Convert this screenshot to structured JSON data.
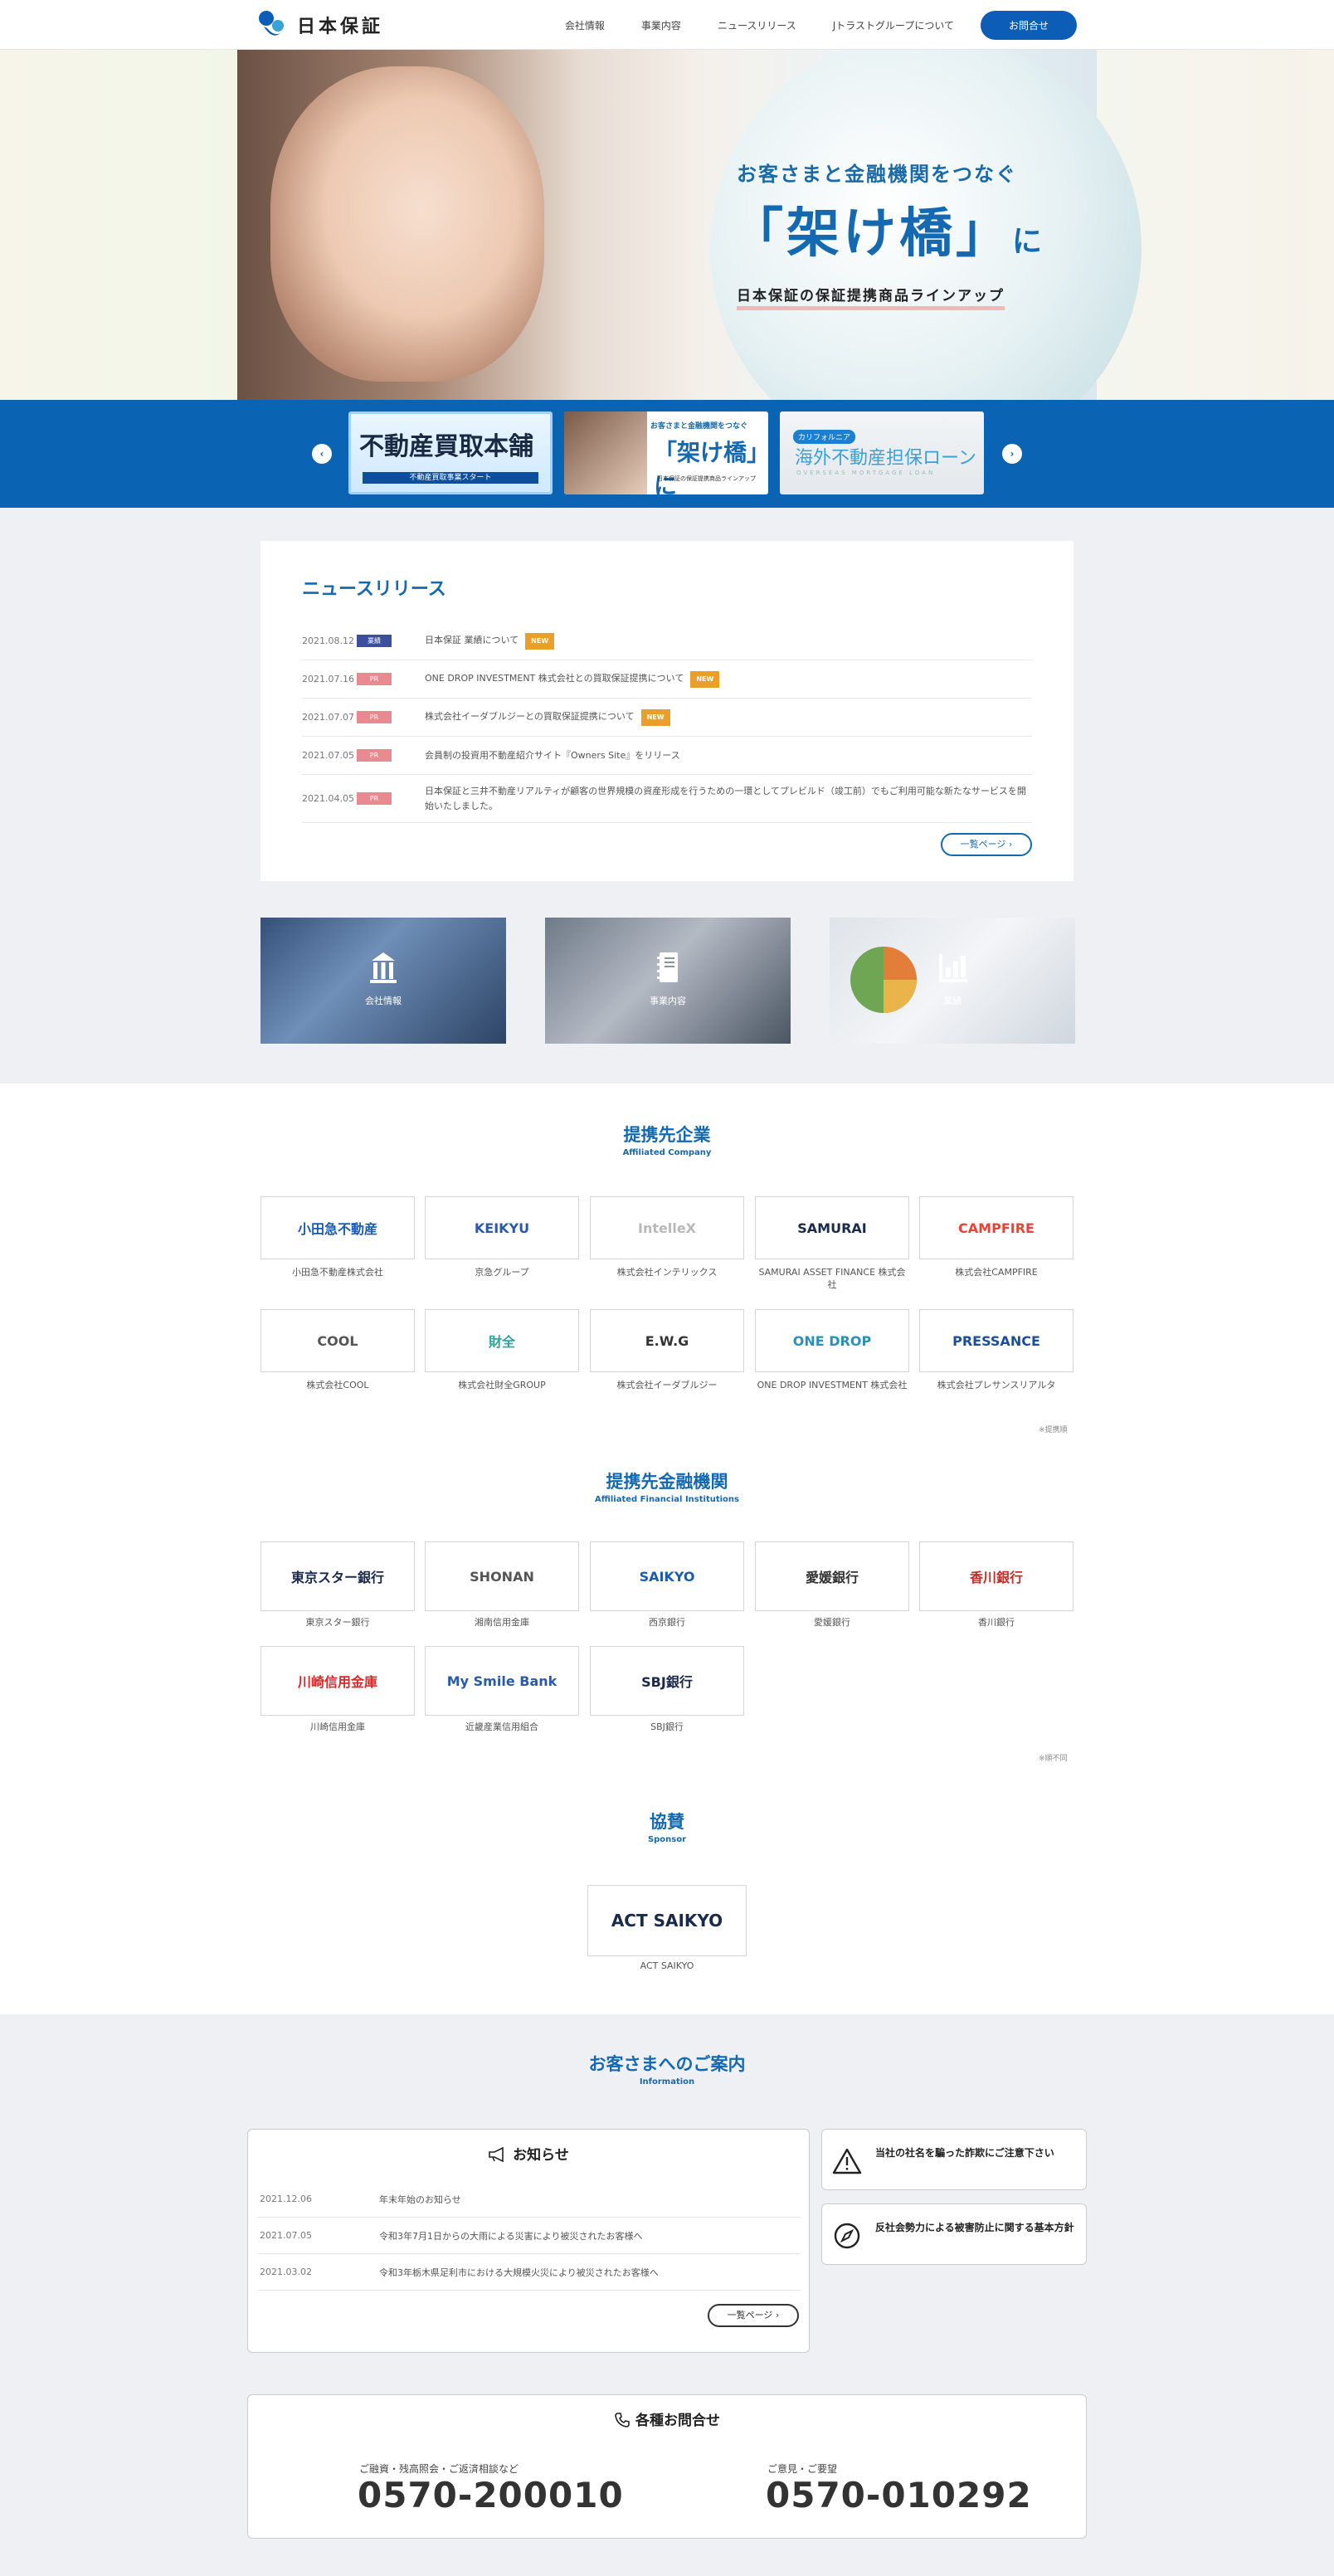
{
  "header": {
    "logo_text": "日本保証",
    "nav": [
      "会社情報",
      "事業内容",
      "ニュースリリース",
      "Jトラストグループについて"
    ],
    "cta": "お問合せ"
  },
  "hero": {
    "sub": "お客さまと金融機関をつなぐ",
    "main": "「架け橋」",
    "main_suffix": "に",
    "line": "日本保証の保証提携商品ラインアップ"
  },
  "carousel": {
    "prev": "‹",
    "next": "›",
    "slide1": {
      "title": "不動産買取本舗",
      "bar": "不動産買取事業スタート"
    },
    "slide2": {
      "sub": "お客さまと金融機関をつなぐ",
      "title": "「架け橋」に",
      "line": "日本保証の保証提携商品ラインアップ"
    },
    "slide3": {
      "tag": "カリフォルニア",
      "title": "海外不動産担保ローン",
      "sub": "OVERSEAS MORTGAGE LOAN"
    }
  },
  "news": {
    "title": "ニュースリリース",
    "items": [
      {
        "date": "2021.08.12",
        "tag": "業績",
        "text": "日本保証 業績について",
        "new": "NEW"
      },
      {
        "date": "2021.07.16",
        "tag": "PR",
        "text": "ONE DROP INVESTMENT 株式会社との買取保証提携について",
        "new": "NEW"
      },
      {
        "date": "2021.07.07",
        "tag": "PR",
        "text": "株式会社イーダブルジーとの買取保証提携について",
        "new": "NEW"
      },
      {
        "date": "2021.07.05",
        "tag": "PR",
        "text": "会員制の投資用不動産紹介サイト『Owners Site』をリリース",
        "new": ""
      },
      {
        "date": "2021.04.05",
        "tag": "PR",
        "text": "日本保証と三井不動産リアルティが顧客の世界規模の資産形成を行うための一環としてプレビルド（竣工前）でもご利用可能な新たなサービスを開始いたしました。",
        "new": ""
      }
    ],
    "more": "一覧ページ ›"
  },
  "tiles": [
    {
      "label": "会社情報",
      "icon": "building-icon"
    },
    {
      "label": "事業内容",
      "icon": "notebook-icon"
    },
    {
      "label": "業績",
      "icon": "bar-chart-icon"
    }
  ],
  "affiliated": {
    "title": "提携先企業",
    "sub": "Affiliated Company",
    "items": [
      {
        "logo": "小田急不動産",
        "name": "小田急不動産株式会社",
        "color": "#1b5bb2"
      },
      {
        "logo": "KEIKYU",
        "name": "京急グループ",
        "color": "#2a5aa8"
      },
      {
        "logo": "IntelleX",
        "name": "株式会社インテリックス",
        "color": "#b8b8b8"
      },
      {
        "logo": "SAMURAI",
        "name": "SAMURAI ASSET FINANCE 株式会社",
        "color": "#1a2a4a"
      },
      {
        "logo": "CAMPFIRE",
        "name": "株式会社CAMPFIRE",
        "color": "#e8423b"
      },
      {
        "logo": "COOL",
        "name": "株式会社COOL",
        "color": "#555555"
      },
      {
        "logo": "財全",
        "name": "株式会社財全GROUP",
        "color": "#2aa59a"
      },
      {
        "logo": "E.W.G",
        "name": "株式会社イーダブルジー",
        "color": "#333333"
      },
      {
        "logo": "ONE DROP",
        "name": "ONE DROP INVESTMENT 株式会社",
        "color": "#2b8fb8"
      },
      {
        "logo": "PRESSANCE",
        "name": "株式会社プレサンスリアルタ",
        "color": "#1b4f9e"
      }
    ],
    "note": "※提携順"
  },
  "financial": {
    "title": "提携先金融機関",
    "sub": "Affiliated Financial Institutions",
    "items": [
      {
        "logo": "東京スター銀行",
        "name": "東京スター銀行",
        "color": "#1a2a4a"
      },
      {
        "logo": "SHONAN",
        "name": "湘南信用金庫",
        "color": "#555555"
      },
      {
        "logo": "SAIKYO",
        "name": "西京銀行",
        "color": "#1b5bb2"
      },
      {
        "logo": "愛媛銀行",
        "name": "愛媛銀行",
        "color": "#333333"
      },
      {
        "logo": "香川銀行",
        "name": "香川銀行",
        "color": "#c2302a"
      },
      {
        "logo": "川崎信用金庫",
        "name": "川崎信用金庫",
        "color": "#d42a2a"
      },
      {
        "logo": "My Smile Bank",
        "name": "近畿産業信用組合",
        "color": "#2a5aa8"
      },
      {
        "logo": "SBJ銀行",
        "name": "SBJ銀行",
        "color": "#1a2a4a"
      }
    ],
    "note": "※順不同"
  },
  "sponsor": {
    "title": "協賛",
    "sub": "Sponsor",
    "logo": "ACT SAIKYO",
    "name": "ACT SAIKYO"
  },
  "info": {
    "title": "お客さまへのご案内",
    "sub": "Information",
    "notice_head": "お知らせ",
    "notices": [
      {
        "date": "2021.12.06",
        "text": "年末年始のお知らせ"
      },
      {
        "date": "2021.07.05",
        "text": "令和3年7月1日からの大雨による災害により被災されたお客様へ"
      },
      {
        "date": "2021.03.02",
        "text": "令和3年栃木県足利市における大規模火災により被災されたお客様へ"
      }
    ],
    "notice_more": "一覧ページ ›",
    "side": [
      {
        "text": "当社の社名を騙った詐欺にご注意下さい",
        "icon": "warning-icon"
      },
      {
        "text": "反社会勢力による被害防止に関する基本方針",
        "icon": "compass-icon"
      }
    ],
    "contact_head": "各種お問合せ",
    "contacts": [
      {
        "label": "ご融資・残高照会・ご返済相談など",
        "number": "0570-200010"
      },
      {
        "label": "ご意見・ご要望",
        "number": "0570-010292"
      }
    ]
  },
  "colors": {
    "brand": "#1569b0",
    "band": "#0b63b4",
    "new": "#e8a02a",
    "pr": "#e88a8f",
    "biz": "#3a4f9e"
  }
}
